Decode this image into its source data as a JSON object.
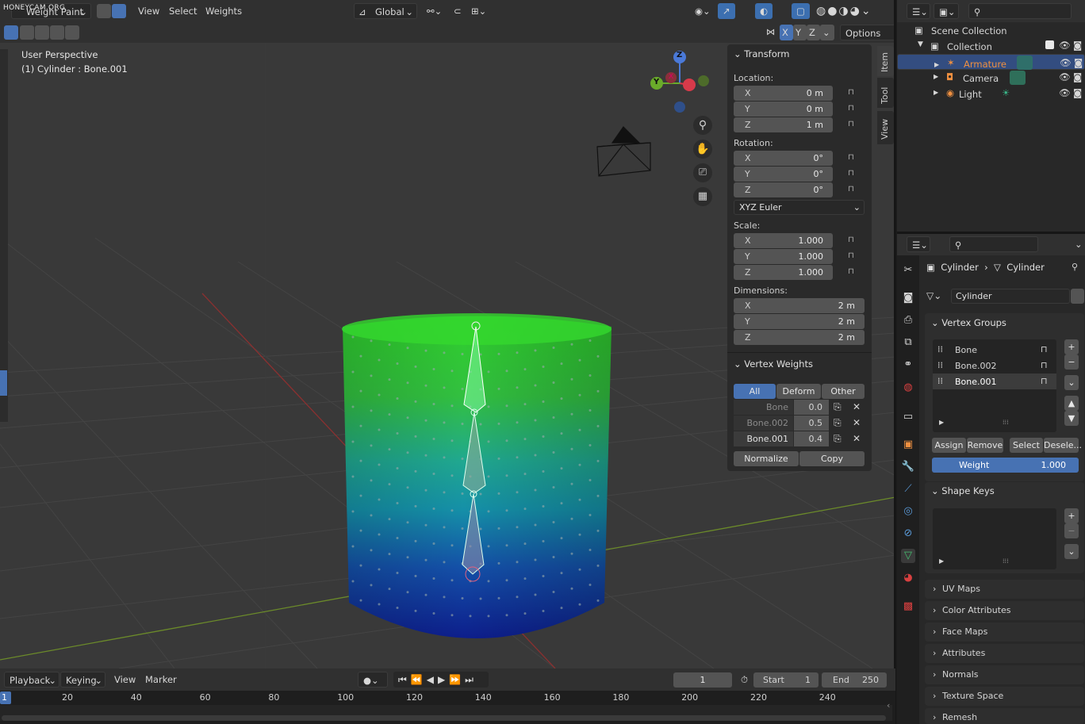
{
  "watermark": "HONEYCAM.ORG",
  "header": {
    "mode": "Weight Paint",
    "menus": [
      "View",
      "Select",
      "Weights"
    ],
    "orientation": "Global",
    "axes": [
      "X",
      "Y",
      "Z"
    ],
    "options": "Options"
  },
  "viewport": {
    "perspective": "User Perspective",
    "object": "(1) Cylinder : Bone.001",
    "gizmo": {
      "z": "Z",
      "y": "Y",
      "x": "X"
    }
  },
  "npanel": {
    "tabs": [
      "Item",
      "Tool",
      "View"
    ],
    "transform_title": "Transform",
    "location_label": "Location:",
    "location": [
      {
        "k": "X",
        "v": "0 m"
      },
      {
        "k": "Y",
        "v": "0 m"
      },
      {
        "k": "Z",
        "v": "1 m"
      }
    ],
    "rotation_label": "Rotation:",
    "rotation": [
      {
        "k": "X",
        "v": "0°"
      },
      {
        "k": "Y",
        "v": "0°"
      },
      {
        "k": "Z",
        "v": "0°"
      }
    ],
    "rotation_mode": "XYZ Euler",
    "scale_label": "Scale:",
    "scale": [
      {
        "k": "X",
        "v": "1.000"
      },
      {
        "k": "Y",
        "v": "1.000"
      },
      {
        "k": "Z",
        "v": "1.000"
      }
    ],
    "dimensions_label": "Dimensions:",
    "dimensions": [
      {
        "k": "X",
        "v": "2 m"
      },
      {
        "k": "Y",
        "v": "2 m"
      },
      {
        "k": "Z",
        "v": "2 m"
      }
    ],
    "vw_title": "Vertex Weights",
    "vw_filters": [
      "All",
      "Deform",
      "Other"
    ],
    "vw_rows": [
      {
        "name": "Bone",
        "value": "0.0"
      },
      {
        "name": "Bone.002",
        "value": "0.5"
      },
      {
        "name": "Bone.001",
        "value": "0.4"
      }
    ],
    "normalize": "Normalize",
    "copy": "Copy"
  },
  "outliner": {
    "title": "Scene Collection",
    "collection": "Collection",
    "items": [
      "Armature",
      "Camera",
      "Light"
    ]
  },
  "properties": {
    "breadcrumb_object": "Cylinder",
    "breadcrumb_data": "Cylinder",
    "mesh_name": "Cylinder",
    "vertex_groups_title": "Vertex Groups",
    "vertex_groups": [
      "Bone",
      "Bone.002",
      "Bone.001"
    ],
    "assign": "Assign",
    "remove": "Remove",
    "select": "Select",
    "deselect": "Desele...",
    "weight_label": "Weight",
    "weight_value": "1.000",
    "shape_keys_title": "Shape Keys",
    "sections": [
      "UV Maps",
      "Color Attributes",
      "Face Maps",
      "Attributes",
      "Normals",
      "Texture Space",
      "Remesh"
    ]
  },
  "timeline": {
    "menus": [
      "Playback",
      "Keying",
      "View",
      "Marker"
    ],
    "current_frame": "1",
    "start_label": "Start",
    "start": "1",
    "end_label": "End",
    "end": "250",
    "ticks": [
      "20",
      "40",
      "60",
      "80",
      "100",
      "120",
      "140",
      "160",
      "180",
      "200",
      "220",
      "240"
    ],
    "cursor": "1"
  },
  "colors": {
    "accent": "#4772b3",
    "header": "#303030",
    "viewport": "#393939",
    "selected_row": "#334d80"
  }
}
